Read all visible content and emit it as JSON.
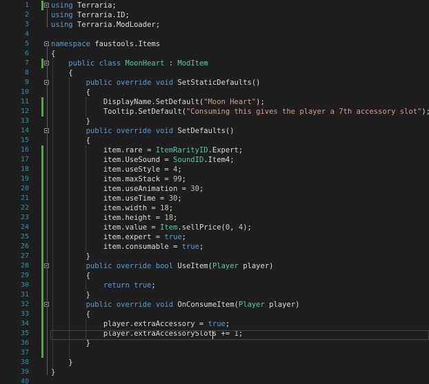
{
  "lines": [
    {
      "num": "1",
      "bar": true,
      "fold": true,
      "tokens": [
        {
          "t": "using",
          "c": "kw"
        },
        {
          "t": " Terraria;",
          "c": "pl"
        }
      ]
    },
    {
      "num": "2",
      "bar": false,
      "fold": false,
      "tokens": [
        {
          "t": "using",
          "c": "kw"
        },
        {
          "t": " Terraria.ID;",
          "c": "pl"
        }
      ]
    },
    {
      "num": "3",
      "bar": false,
      "fold": false,
      "tokens": [
        {
          "t": "using",
          "c": "kw"
        },
        {
          "t": " Terraria.ModLoader;",
          "c": "pl"
        }
      ]
    },
    {
      "num": "4",
      "bar": false,
      "fold": false,
      "tokens": []
    },
    {
      "num": "5",
      "bar": false,
      "fold": true,
      "tokens": [
        {
          "t": "namespace",
          "c": "kw"
        },
        {
          "t": " faustools.Items",
          "c": "pl"
        }
      ]
    },
    {
      "num": "6",
      "bar": false,
      "fold": false,
      "tokens": [
        {
          "t": "{",
          "c": "pl"
        }
      ]
    },
    {
      "num": "7",
      "bar": true,
      "fold": true,
      "tokens": [
        {
          "t": "    ",
          "c": "pl"
        },
        {
          "t": "public",
          "c": "kw"
        },
        {
          "t": " ",
          "c": "pl"
        },
        {
          "t": "class",
          "c": "kw"
        },
        {
          "t": " ",
          "c": "pl"
        },
        {
          "t": "MoonHeart",
          "c": "ty"
        },
        {
          "t": " : ",
          "c": "pl"
        },
        {
          "t": "ModItem",
          "c": "ty"
        }
      ]
    },
    {
      "num": "8",
      "bar": false,
      "fold": false,
      "tokens": [
        {
          "t": "    {",
          "c": "pl"
        }
      ]
    },
    {
      "num": "9",
      "bar": false,
      "fold": true,
      "tokens": [
        {
          "t": "        ",
          "c": "pl"
        },
        {
          "t": "public",
          "c": "kw"
        },
        {
          "t": " ",
          "c": "pl"
        },
        {
          "t": "override",
          "c": "kw"
        },
        {
          "t": " ",
          "c": "pl"
        },
        {
          "t": "void",
          "c": "kw"
        },
        {
          "t": " SetStaticDefaults()",
          "c": "pl"
        }
      ]
    },
    {
      "num": "10",
      "bar": false,
      "fold": false,
      "tokens": [
        {
          "t": "        {",
          "c": "pl"
        }
      ]
    },
    {
      "num": "11",
      "bar": true,
      "fold": false,
      "tokens": [
        {
          "t": "            DisplayName.SetDefault(",
          "c": "pl"
        },
        {
          "t": "\"Moon Heart\"",
          "c": "st"
        },
        {
          "t": ");",
          "c": "pl"
        }
      ]
    },
    {
      "num": "12",
      "bar": true,
      "fold": false,
      "tokens": [
        {
          "t": "            Tooltip.SetDefault(",
          "c": "pl"
        },
        {
          "t": "\"Consuming this gives the player a 7th accessory slot\"",
          "c": "st"
        },
        {
          "t": ");",
          "c": "pl"
        }
      ]
    },
    {
      "num": "13",
      "bar": false,
      "fold": false,
      "tokens": [
        {
          "t": "        }",
          "c": "pl"
        }
      ]
    },
    {
      "num": "14",
      "bar": false,
      "fold": true,
      "tokens": [
        {
          "t": "        ",
          "c": "pl"
        },
        {
          "t": "public",
          "c": "kw"
        },
        {
          "t": " ",
          "c": "pl"
        },
        {
          "t": "override",
          "c": "kw"
        },
        {
          "t": " ",
          "c": "pl"
        },
        {
          "t": "void",
          "c": "kw"
        },
        {
          "t": " SetDefaults()",
          "c": "pl"
        }
      ]
    },
    {
      "num": "15",
      "bar": false,
      "fold": false,
      "tokens": [
        {
          "t": "        {",
          "c": "pl"
        }
      ]
    },
    {
      "num": "16",
      "bar": true,
      "fold": false,
      "tokens": [
        {
          "t": "            item.rare = ",
          "c": "pl"
        },
        {
          "t": "ItemRarityID",
          "c": "ty"
        },
        {
          "t": ".Expert;",
          "c": "pl"
        }
      ]
    },
    {
      "num": "17",
      "bar": true,
      "fold": false,
      "tokens": [
        {
          "t": "            item.UseSound = ",
          "c": "pl"
        },
        {
          "t": "SoundID",
          "c": "ty"
        },
        {
          "t": ".Item4;",
          "c": "pl"
        }
      ]
    },
    {
      "num": "18",
      "bar": true,
      "fold": false,
      "tokens": [
        {
          "t": "            item.useStyle = ",
          "c": "pl"
        },
        {
          "t": "4",
          "c": "nm"
        },
        {
          "t": ";",
          "c": "pl"
        }
      ]
    },
    {
      "num": "19",
      "bar": true,
      "fold": false,
      "tokens": [
        {
          "t": "            item.maxStack = ",
          "c": "pl"
        },
        {
          "t": "99",
          "c": "nm"
        },
        {
          "t": ";",
          "c": "pl"
        }
      ]
    },
    {
      "num": "20",
      "bar": true,
      "fold": false,
      "tokens": [
        {
          "t": "            item.useAnimation = ",
          "c": "pl"
        },
        {
          "t": "30",
          "c": "nm"
        },
        {
          "t": ";",
          "c": "pl"
        }
      ]
    },
    {
      "num": "21",
      "bar": true,
      "fold": false,
      "tokens": [
        {
          "t": "            item.useTime = ",
          "c": "pl"
        },
        {
          "t": "30",
          "c": "nm"
        },
        {
          "t": ";",
          "c": "pl"
        }
      ]
    },
    {
      "num": "22",
      "bar": true,
      "fold": false,
      "tokens": [
        {
          "t": "            item.width = ",
          "c": "pl"
        },
        {
          "t": "18",
          "c": "nm"
        },
        {
          "t": ";",
          "c": "pl"
        }
      ]
    },
    {
      "num": "23",
      "bar": true,
      "fold": false,
      "tokens": [
        {
          "t": "            item.height = ",
          "c": "pl"
        },
        {
          "t": "18",
          "c": "nm"
        },
        {
          "t": ";",
          "c": "pl"
        }
      ]
    },
    {
      "num": "24",
      "bar": true,
      "fold": false,
      "tokens": [
        {
          "t": "            item.value = ",
          "c": "pl"
        },
        {
          "t": "Item",
          "c": "ty"
        },
        {
          "t": ".sellPrice(",
          "c": "pl"
        },
        {
          "t": "0",
          "c": "nm"
        },
        {
          "t": ", ",
          "c": "pl"
        },
        {
          "t": "4",
          "c": "nm"
        },
        {
          "t": ");",
          "c": "pl"
        }
      ]
    },
    {
      "num": "25",
      "bar": true,
      "fold": false,
      "tokens": [
        {
          "t": "            item.expert = ",
          "c": "pl"
        },
        {
          "t": "true",
          "c": "kw"
        },
        {
          "t": ";",
          "c": "pl"
        }
      ]
    },
    {
      "num": "26",
      "bar": true,
      "fold": false,
      "tokens": [
        {
          "t": "            item.consumable = ",
          "c": "pl"
        },
        {
          "t": "true",
          "c": "kw"
        },
        {
          "t": ";",
          "c": "pl"
        }
      ]
    },
    {
      "num": "27",
      "bar": true,
      "fold": false,
      "tokens": [
        {
          "t": "        }",
          "c": "pl"
        }
      ]
    },
    {
      "num": "28",
      "bar": true,
      "fold": true,
      "tokens": [
        {
          "t": "        ",
          "c": "pl"
        },
        {
          "t": "public",
          "c": "kw"
        },
        {
          "t": " ",
          "c": "pl"
        },
        {
          "t": "override",
          "c": "kw"
        },
        {
          "t": " ",
          "c": "pl"
        },
        {
          "t": "bool",
          "c": "kw"
        },
        {
          "t": " UseItem(",
          "c": "pl"
        },
        {
          "t": "Player",
          "c": "ty"
        },
        {
          "t": " player)",
          "c": "pl"
        }
      ]
    },
    {
      "num": "29",
      "bar": true,
      "fold": false,
      "tokens": [
        {
          "t": "        {",
          "c": "pl"
        }
      ]
    },
    {
      "num": "30",
      "bar": true,
      "fold": false,
      "tokens": [
        {
          "t": "            ",
          "c": "pl"
        },
        {
          "t": "return",
          "c": "kw"
        },
        {
          "t": " ",
          "c": "pl"
        },
        {
          "t": "true",
          "c": "kw"
        },
        {
          "t": ";",
          "c": "pl"
        }
      ]
    },
    {
      "num": "31",
      "bar": true,
      "fold": false,
      "tokens": [
        {
          "t": "        }",
          "c": "pl"
        }
      ]
    },
    {
      "num": "32",
      "bar": true,
      "fold": true,
      "tokens": [
        {
          "t": "        ",
          "c": "pl"
        },
        {
          "t": "public",
          "c": "kw"
        },
        {
          "t": " ",
          "c": "pl"
        },
        {
          "t": "override",
          "c": "kw"
        },
        {
          "t": " ",
          "c": "pl"
        },
        {
          "t": "void",
          "c": "kw"
        },
        {
          "t": " OnConsumeItem(",
          "c": "pl"
        },
        {
          "t": "Player",
          "c": "ty"
        },
        {
          "t": " player)",
          "c": "pl"
        }
      ]
    },
    {
      "num": "33",
      "bar": true,
      "fold": false,
      "tokens": [
        {
          "t": "        {",
          "c": "pl"
        }
      ]
    },
    {
      "num": "34",
      "bar": true,
      "fold": false,
      "tokens": [
        {
          "t": "            player.extraAccessory = ",
          "c": "pl"
        },
        {
          "t": "true",
          "c": "kw"
        },
        {
          "t": ";",
          "c": "pl"
        }
      ]
    },
    {
      "num": "35",
      "bar": true,
      "fold": false,
      "tokens": [
        {
          "t": "            player.extraAccessorySlots += ",
          "c": "pl"
        },
        {
          "t": "1",
          "c": "nm"
        },
        {
          "t": ";",
          "c": "pl"
        }
      ]
    },
    {
      "num": "36",
      "bar": true,
      "fold": false,
      "tokens": [
        {
          "t": "        }",
          "c": "pl"
        }
      ]
    },
    {
      "num": "37",
      "bar": true,
      "fold": false,
      "tokens": []
    },
    {
      "num": "38",
      "bar": false,
      "fold": false,
      "tokens": [
        {
          "t": "    }",
          "c": "pl"
        }
      ]
    },
    {
      "num": "39",
      "bar": false,
      "fold": false,
      "tokens": [
        {
          "t": "}",
          "c": "pl"
        }
      ]
    },
    {
      "num": "40",
      "bar": false,
      "fold": false,
      "tokens": []
    }
  ]
}
